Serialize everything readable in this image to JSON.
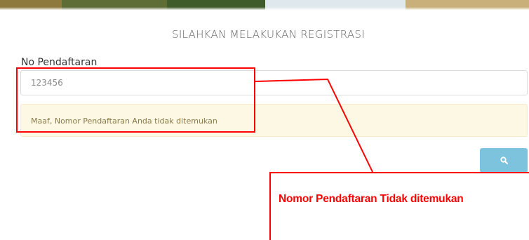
{
  "registration": {
    "heading": "SILAHKAN MELAKUKAN REGISTRASI",
    "field_label": "No Pendaftaran",
    "input_value": "123456",
    "alert_message": "Maaf, Nomor Pendaftaran Anda tidak ditemukan",
    "search_icon": "search-icon"
  },
  "annotation": {
    "callout_text": "Nomor Pendaftaran Tidak ditemukan",
    "color": "#ff0000"
  },
  "colors": {
    "button": "#7ec3dd",
    "alert_bg": "#fcf8e3"
  }
}
